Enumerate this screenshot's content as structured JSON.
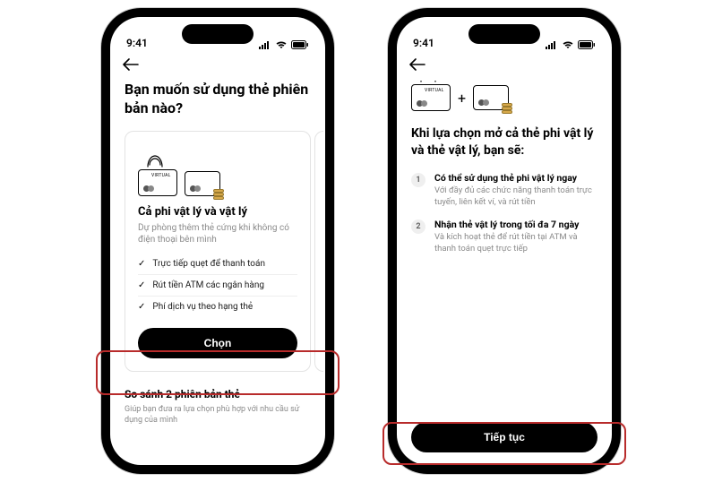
{
  "status": {
    "time": "9:41"
  },
  "screen1": {
    "title": "Bạn muốn sử dụng thẻ phiên bản nào?",
    "card": {
      "heading": "Cả phi vật lý và vật lý",
      "sub": "Dự phòng thêm thẻ cứng khi không có điện thoại bên mình",
      "features": [
        "Trực tiếp quẹt để thanh toán",
        "Rút tiền ATM các ngân hàng",
        "Phí dịch vụ theo hạng thẻ"
      ],
      "button": "Chọn"
    },
    "compare": {
      "title": "So sánh 2 phiên bản thẻ",
      "sub": "Giúp bạn đưa ra lựa chọn phù hợp với nhu cầu sử dụng của mình"
    }
  },
  "screen2": {
    "title": "Khi lựa chọn mở cả thẻ phi vật lý và thẻ vật lý, bạn sẽ:",
    "steps": [
      {
        "num": "1",
        "title": "Có thể sử dụng thẻ phi vật lý ngay",
        "sub": "Với đầy đủ các chức năng thanh toán trực tuyến, liên kết ví, và rút tiền"
      },
      {
        "num": "2",
        "title": "Nhận thẻ vật lý trong tối đa 7 ngày",
        "sub": "Và kích hoạt thẻ để rút tiền tại ATM và thanh toán quẹt trực tiếp"
      }
    ],
    "button": "Tiếp tục"
  },
  "icons": {
    "virtual_label": "VIRTUAL"
  }
}
